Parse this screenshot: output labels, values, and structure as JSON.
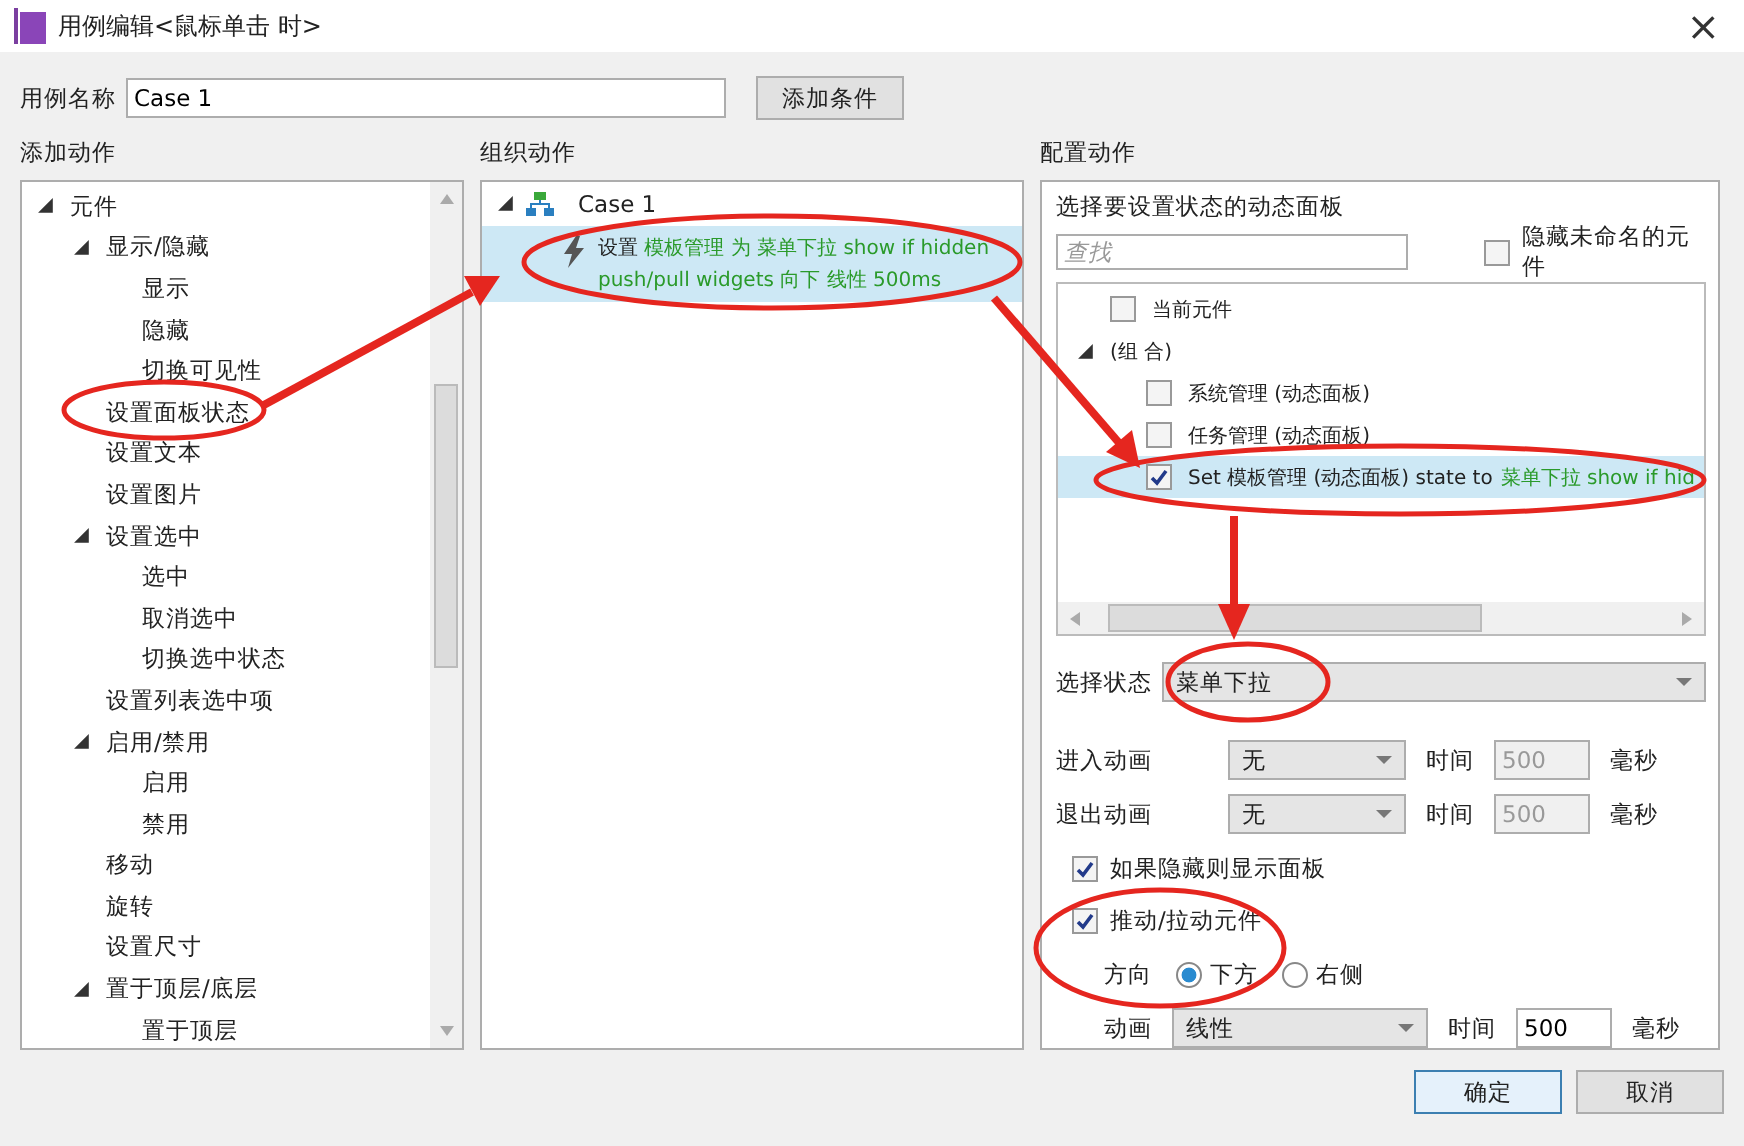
{
  "window": {
    "title": "用例编辑<鼠标单击 时>",
    "close": "×"
  },
  "case_name": {
    "label": "用例名称",
    "value": "Case 1",
    "add_condition": "添加条件"
  },
  "add_actions": {
    "heading": "添加动作",
    "tree": [
      {
        "label": "元件",
        "expanded": true,
        "children": [
          {
            "label": "显示/隐藏",
            "expanded": true,
            "children": [
              {
                "label": "显示"
              },
              {
                "label": "隐藏"
              },
              {
                "label": "切换可见性"
              }
            ]
          },
          {
            "label": "设置面板状态"
          },
          {
            "label": "设置文本"
          },
          {
            "label": "设置图片"
          },
          {
            "label": "设置选中",
            "expanded": true,
            "children": [
              {
                "label": "选中"
              },
              {
                "label": "取消选中"
              },
              {
                "label": "切换选中状态"
              }
            ]
          },
          {
            "label": "设置列表选中项"
          },
          {
            "label": "启用/禁用",
            "expanded": true,
            "children": [
              {
                "label": "启用"
              },
              {
                "label": "禁用"
              }
            ]
          },
          {
            "label": "移动"
          },
          {
            "label": "旋转"
          },
          {
            "label": "设置尺寸"
          },
          {
            "label": "置于顶层/底层",
            "expanded": true,
            "children": [
              {
                "label": "置于顶层"
              }
            ]
          }
        ]
      }
    ]
  },
  "organize": {
    "heading": "组织动作",
    "case": {
      "label": "Case 1",
      "expanded": true
    },
    "actions": [
      {
        "verb": "设置",
        "lines": [
          "模板管理 为 菜单下拉 show if hidden",
          "push/pull widgets 向下 线性 500ms"
        ],
        "selected": true
      }
    ]
  },
  "configure": {
    "heading": "配置动作",
    "prompt": "选择要设置状态的动态面板",
    "search": {
      "placeholder": "查找"
    },
    "hide_unnamed": {
      "label": "隐藏未命名的元件",
      "checked": false
    },
    "panels": [
      {
        "kind": "checkbox",
        "label": "当前元件",
        "checked": false,
        "selected": false
      },
      {
        "kind": "group",
        "label": "(组 合)",
        "expanded": true,
        "children": [
          {
            "kind": "checkbox",
            "label": "系统管理 (动态面板)",
            "checked": false,
            "selected": false
          },
          {
            "kind": "checkbox",
            "label": "任务管理 (动态面板)",
            "checked": false,
            "selected": false
          },
          {
            "kind": "checkbox",
            "label": "Set 模板管理 (动态面板) state to",
            "detail": "菜单下拉 show if hid",
            "checked": true,
            "selected": true
          }
        ]
      }
    ],
    "state": {
      "label": "选择状态",
      "value": "菜单下拉"
    },
    "animations": [
      {
        "label": "进入动画",
        "value": "无",
        "time_label": "时间",
        "time": "500",
        "unit": "毫秒",
        "disabled": true
      },
      {
        "label": "退出动画",
        "value": "无",
        "time_label": "时间",
        "time": "500",
        "unit": "毫秒",
        "disabled": true
      }
    ],
    "show_if_hidden": {
      "label": "如果隐藏则显示面板",
      "checked": true
    },
    "push_pull": {
      "label": "推动/拉动元件",
      "checked": true
    },
    "direction": {
      "label": "方向",
      "options": [
        {
          "label": "下方",
          "selected": true
        },
        {
          "label": "右侧",
          "selected": false
        }
      ]
    },
    "push_animation": {
      "label": "动画",
      "value": "线性",
      "time_label": "时间",
      "time": "500",
      "unit": "毫秒",
      "disabled": false
    }
  },
  "buttons": [
    {
      "label": "确定",
      "default": true
    },
    {
      "label": "取消",
      "default": false
    }
  ]
}
